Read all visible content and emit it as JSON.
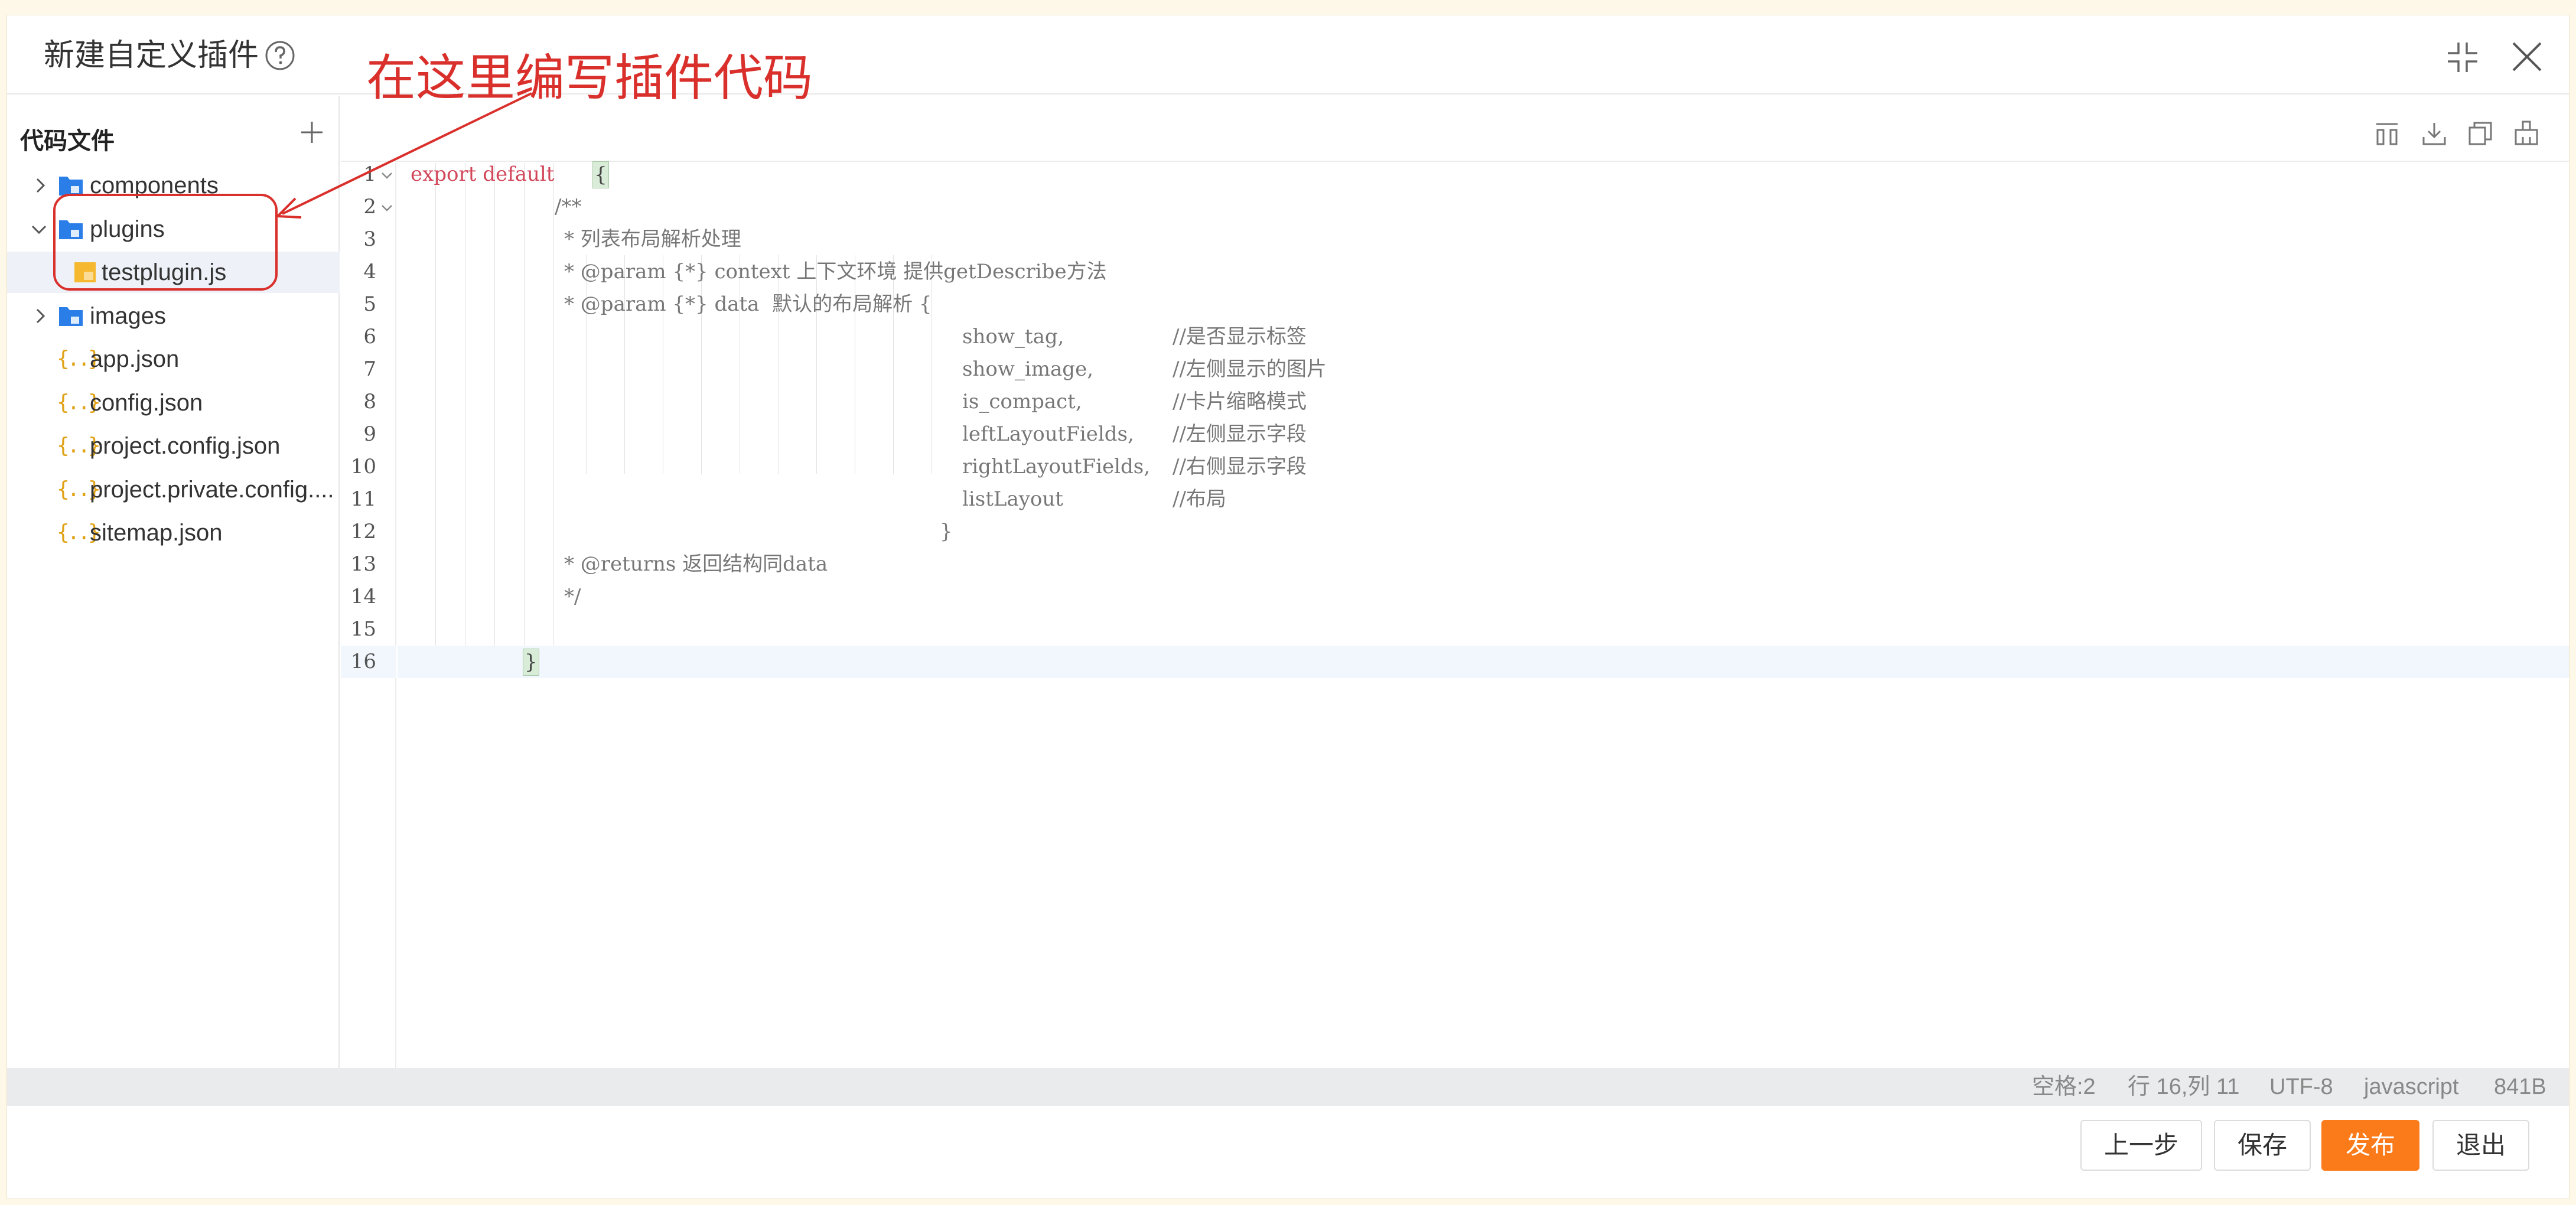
{
  "dialog": {
    "title": "新建自定义插件"
  },
  "annotation": {
    "text": "在这里编写插件代码"
  },
  "sidebar": {
    "title": "代码文件",
    "items": [
      {
        "label": "components",
        "type": "folder",
        "expanded": false
      },
      {
        "label": "plugins",
        "type": "folder",
        "expanded": true
      },
      {
        "label": "testplugin.js",
        "type": "js-file",
        "selected": true
      },
      {
        "label": "images",
        "type": "folder",
        "expanded": false
      },
      {
        "label": "app.json",
        "type": "json-file"
      },
      {
        "label": "config.json",
        "type": "json-file"
      },
      {
        "label": "project.config.json",
        "type": "json-file"
      },
      {
        "label": "project.private.config....",
        "type": "json-file"
      },
      {
        "label": "sitemap.json",
        "type": "json-file"
      }
    ],
    "json_icon_glyph": "{..}"
  },
  "editor": {
    "line_numbers": [
      "1",
      "2",
      "3",
      "4",
      "5",
      "6",
      "7",
      "8",
      "9",
      "10",
      "11",
      "12",
      "13",
      "14",
      "15",
      "16"
    ],
    "code": {
      "l1_kw": "export default",
      "l1_brace": "{",
      "l2": "/**",
      "l3": "* 列表布局解析处理",
      "l4": "* @param {*} context 上下文环境 提供getDescribe方法",
      "l5": "* @param {*} data  默认的布局解析 {",
      "l6_key": "show_tag,",
      "l6_cmt": "//是否显示标签",
      "l7_key": "show_image,",
      "l7_cmt": "//左侧显示的图片",
      "l8_key": "is_compact,",
      "l8_cmt": "//卡片缩略模式",
      "l9_key": "leftLayoutFields,",
      "l9_cmt": "//左侧显示字段",
      "l10_key": "rightLayoutFields,",
      "l10_cmt": "//右侧显示字段",
      "l11_key": "listLayout",
      "l11_cmt": "//布局",
      "l12": "}",
      "l13": "* @returns 返回结构同data",
      "l14": "*/",
      "l16": "}"
    }
  },
  "statusbar": {
    "spaces": "空格:2",
    "position": "行 16,列 11",
    "encoding": "UTF-8",
    "language": "javascript",
    "size": "841B"
  },
  "footer": {
    "prev_label": "上一步",
    "save_label": "保存",
    "publish_label": "发布",
    "exit_label": "退出"
  },
  "colors": {
    "accent": "#fb7b1b",
    "annotation": "#d9302c",
    "keyword": "#d2465a",
    "folder": "#2b7ee8",
    "js_file": "#f5b82e"
  }
}
